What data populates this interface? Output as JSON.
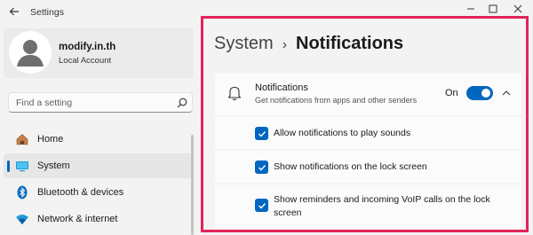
{
  "window": {
    "title": "Settings"
  },
  "profile": {
    "name": "modify.in.th",
    "account_type": "Local Account"
  },
  "search": {
    "placeholder": "Find a setting"
  },
  "sidebar": {
    "items": [
      {
        "label": "Home",
        "icon": "home-icon",
        "selected": false
      },
      {
        "label": "System",
        "icon": "system-display-icon",
        "selected": true
      },
      {
        "label": "Bluetooth & devices",
        "icon": "bluetooth-icon",
        "selected": false
      },
      {
        "label": "Network & internet",
        "icon": "wifi-icon",
        "selected": false
      }
    ]
  },
  "breadcrumb": {
    "parent": "System",
    "separator": "›",
    "current": "Notifications"
  },
  "notifications": {
    "title": "Notifications",
    "description": "Get notifications from apps and other senders",
    "toggle_state_label": "On",
    "toggle_on": true,
    "expanded": true
  },
  "options": [
    {
      "label": "Allow notifications to play sounds",
      "checked": true
    },
    {
      "label": "Show notifications on the lock screen",
      "checked": true
    },
    {
      "label": "Show reminders and incoming VoIP calls on the lock",
      "label_line2": "screen",
      "checked": true
    }
  ],
  "colors": {
    "accent": "#0067c0",
    "highlight_border": "#e2245a",
    "background": "#f3f3f3",
    "card": "#fbfbfb"
  }
}
